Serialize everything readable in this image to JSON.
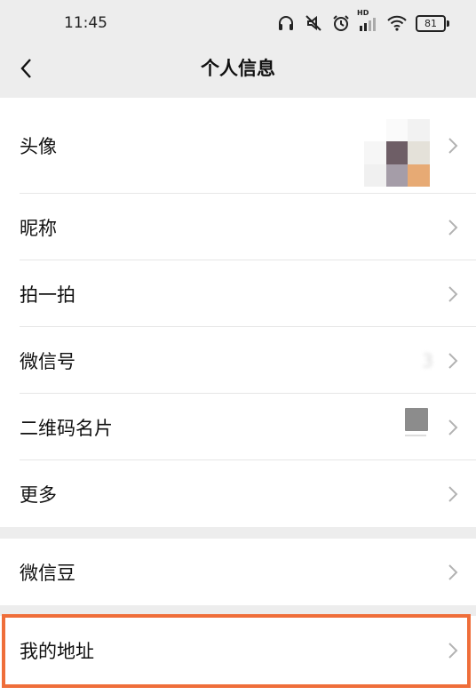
{
  "status_bar": {
    "time": "11:45",
    "battery": "81",
    "hd_label": "HD",
    "icons": [
      "headphones-icon",
      "mute-icon",
      "alarm-icon",
      "signal-icon",
      "wifi-icon",
      "battery-icon"
    ]
  },
  "nav": {
    "title": "个人信息",
    "back_icon": "chevron-left-icon"
  },
  "rows": {
    "avatar": {
      "label": "头像"
    },
    "nickname": {
      "label": "昵称",
      "value": ""
    },
    "pat": {
      "label": "拍一拍"
    },
    "wechat_id": {
      "label": "微信号",
      "value": "3"
    },
    "qr_code": {
      "label": "二维码名片"
    },
    "more": {
      "label": "更多"
    },
    "wechat_beans": {
      "label": "微信豆"
    },
    "my_address": {
      "label": "我的地址"
    }
  },
  "colors": {
    "background": "#ededed",
    "card": "#ffffff",
    "highlight": "#ef6e3a",
    "chevron": "#b2b2b2"
  }
}
